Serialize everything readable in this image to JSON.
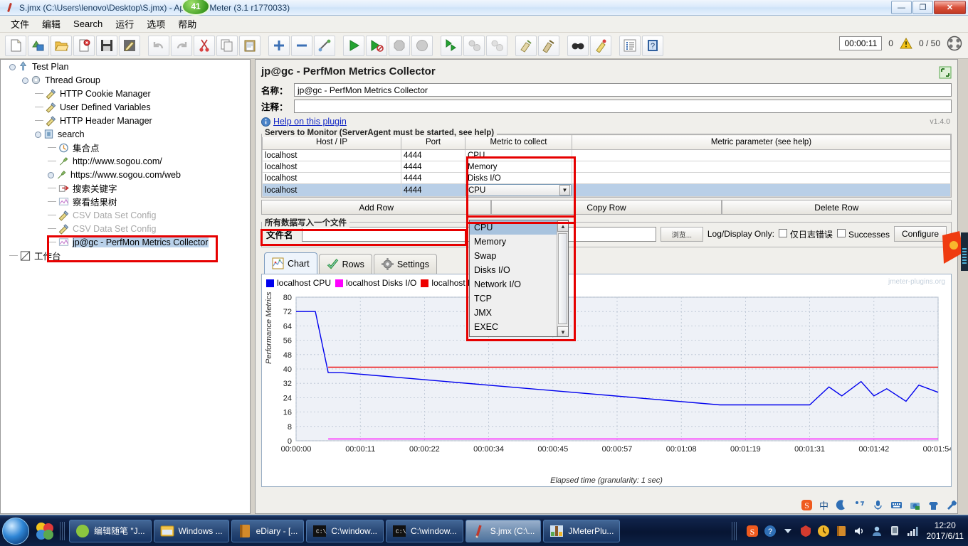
{
  "window": {
    "title": "S.jmx (C:\\Users\\lenovo\\Desktop\\S.jmx) - Apache JMeter (3.1 r1770033)",
    "badge": "41",
    "minimize": "—",
    "restore": "❐",
    "close": "✕"
  },
  "menu": {
    "items": [
      "文件",
      "编辑",
      "Search",
      "运行",
      "选项",
      "帮助"
    ]
  },
  "toolbar": {
    "icons": [
      "new-icon",
      "templates-icon",
      "open-icon",
      "close-icon",
      "save-icon",
      "save-as-icon",
      "undo-icon",
      "redo-icon",
      "cut-icon",
      "copy-icon",
      "paste-icon",
      "expand-all-icon",
      "collapse-all-icon",
      "toggle-icon",
      "start-icon",
      "start-no-timers-icon",
      "stop-icon",
      "shutdown-icon",
      "remote-start-all-icon",
      "remote-stop-all-icon",
      "remote-shutdown-all-icon",
      "clear-icon",
      "clear-all-icon",
      "search-icon",
      "search-reset-icon",
      "function-helper-icon",
      "help-icon"
    ],
    "elapsed": "00:00:11",
    "warning_count": "0",
    "thread_count": "0 / 50"
  },
  "tree": {
    "items": [
      {
        "label": "Test Plan",
        "indent": 0,
        "icon": "test-plan-icon",
        "disabled": false,
        "selected": false,
        "knob": true
      },
      {
        "label": "Thread Group",
        "indent": 1,
        "icon": "thread-group-icon",
        "disabled": false,
        "selected": false,
        "knob": true
      },
      {
        "label": "HTTP Cookie Manager",
        "indent": 2,
        "icon": "config-icon",
        "disabled": false,
        "selected": false,
        "knob": false
      },
      {
        "label": "User Defined Variables",
        "indent": 2,
        "icon": "config-icon",
        "disabled": false,
        "selected": false,
        "knob": false
      },
      {
        "label": "HTTP Header Manager",
        "indent": 2,
        "icon": "config-icon",
        "disabled": false,
        "selected": false,
        "knob": false
      },
      {
        "label": "search",
        "indent": 2,
        "icon": "controller-icon",
        "disabled": false,
        "selected": false,
        "knob": true
      },
      {
        "label": "集合点",
        "indent": 3,
        "icon": "timer-icon",
        "disabled": false,
        "selected": false,
        "knob": false
      },
      {
        "label": "http://www.sogou.com/",
        "indent": 3,
        "icon": "sampler-icon",
        "disabled": false,
        "selected": false,
        "knob": false
      },
      {
        "label": "https://www.sogou.com/web",
        "indent": 3,
        "icon": "sampler-icon",
        "disabled": false,
        "selected": false,
        "knob": true
      },
      {
        "label": "搜索关键字",
        "indent": 3,
        "icon": "post-processor-icon",
        "disabled": false,
        "selected": false,
        "knob": false
      },
      {
        "label": "察看结果树",
        "indent": 3,
        "icon": "listener-icon",
        "disabled": false,
        "selected": false,
        "knob": false
      },
      {
        "label": "CSV Data Set Config",
        "indent": 3,
        "icon": "config-icon",
        "disabled": true,
        "selected": false,
        "knob": false
      },
      {
        "label": "CSV Data Set Config",
        "indent": 3,
        "icon": "config-icon",
        "disabled": true,
        "selected": false,
        "knob": false
      },
      {
        "label": "jp@gc - PerfMon Metrics Collector",
        "indent": 3,
        "icon": "listener-icon",
        "disabled": false,
        "selected": true,
        "knob": false
      },
      {
        "label": "工作台",
        "indent": 0,
        "icon": "workbench-icon",
        "disabled": false,
        "selected": false,
        "knob": false
      }
    ]
  },
  "panel": {
    "title": "jp@gc - PerfMon Metrics Collector",
    "name_label": "名称：",
    "name_value": "jp@gc - PerfMon Metrics Collector",
    "comment_label": "注释：",
    "comment_value": "",
    "help_link": "Help on this plugin",
    "version": "v1.4.0",
    "servers_legend": "Servers to Monitor (ServerAgent must be started, see help)",
    "table": {
      "headers": [
        "Host / IP",
        "Port",
        "Metric to collect",
        "Metric parameter (see help)"
      ],
      "rows": [
        {
          "host": "localhost",
          "port": "4444",
          "metric": "CPU",
          "param": "",
          "selected": false,
          "editing": false
        },
        {
          "host": "localhost",
          "port": "4444",
          "metric": "Memory",
          "param": "",
          "selected": false,
          "editing": false
        },
        {
          "host": "localhost",
          "port": "4444",
          "metric": "Disks I/O",
          "param": "",
          "selected": false,
          "editing": false
        },
        {
          "host": "localhost",
          "port": "4444",
          "metric": "CPU",
          "param": "",
          "selected": true,
          "editing": true
        }
      ]
    },
    "buttons": {
      "add_row": "Add Row",
      "copy_row": "Copy Row",
      "delete_row": "Delete Row"
    },
    "file_legend": "所有数据写入一个文件",
    "file_label": "文件名",
    "file_value": "",
    "browse": "浏览...",
    "log_display_only": "Log/Display Only:",
    "errors_only": "仅日志错误",
    "successes": "Successes",
    "configure": "Configure"
  },
  "metric_dropdown": {
    "options": [
      "CPU",
      "Memory",
      "Swap",
      "Disks I/O",
      "Network I/O",
      "TCP",
      "JMX",
      "EXEC"
    ],
    "selected": "CPU",
    "up_arrow": "▲",
    "down_arrow": "▼"
  },
  "tabs": [
    {
      "label": "Chart",
      "icon": "chart-icon",
      "active": true
    },
    {
      "label": "Rows",
      "icon": "rows-check-icon",
      "active": false
    },
    {
      "label": "Settings",
      "icon": "gear-icon",
      "active": false
    }
  ],
  "chart_data": {
    "type": "line",
    "title": "",
    "xlabel": "Elapsed time (granularity: 1 sec)",
    "ylabel": "Performance Metrics",
    "watermark": "jmeter-plugins.org",
    "ylim": [
      0,
      80
    ],
    "yticks": [
      0,
      8,
      16,
      24,
      32,
      40,
      48,
      56,
      64,
      72,
      80
    ],
    "xticks": [
      "00:00:00",
      "00:00:11",
      "00:00:22",
      "00:00:34",
      "00:00:45",
      "00:00:57",
      "00:01:08",
      "00:01:19",
      "00:01:31",
      "00:01:42",
      "00:01:54"
    ],
    "grid": true,
    "legend_position": "top-left",
    "legend": [
      {
        "label": "localhost CPU",
        "color": "#0000ee"
      },
      {
        "label": "localhost Disks I/O",
        "color": "#ff00ff"
      },
      {
        "label": "localhost Memory",
        "color": "#ee0000"
      }
    ],
    "series": [
      {
        "name": "localhost CPU",
        "color": "#0000ee",
        "x": [
          0,
          3,
          5,
          7,
          66,
          80,
          83,
          85,
          88,
          90,
          92,
          95,
          97,
          100
        ],
        "values": [
          72,
          72,
          38,
          38,
          20,
          20,
          30,
          25,
          33,
          25,
          29,
          22,
          31,
          27
        ]
      },
      {
        "name": "localhost Memory",
        "color": "#ee0000",
        "x": [
          5,
          100
        ],
        "values": [
          41,
          41
        ]
      },
      {
        "name": "localhost Disks I/O",
        "color": "#ff00ff",
        "x": [
          5,
          100
        ],
        "values": [
          1,
          1
        ]
      }
    ]
  },
  "taskbar": {
    "tasks": [
      {
        "label": "编辑随笔 \"J...",
        "icon": "browser-icon",
        "active": false
      },
      {
        "label": "Windows ...",
        "icon": "explorer-icon",
        "active": false
      },
      {
        "label": "eDiary - [...",
        "icon": "ediary-icon",
        "active": false
      },
      {
        "label": "C:\\window...",
        "icon": "cmd-icon",
        "active": false
      },
      {
        "label": "C:\\window...",
        "icon": "cmd-icon",
        "active": false
      },
      {
        "label": "S.jmx (C:\\...",
        "icon": "jmeter-icon",
        "active": true
      },
      {
        "label": "JMeterPlu...",
        "icon": "jmeterplugins-icon",
        "active": false
      }
    ],
    "tray": [
      "sogou-icon",
      "help-icon",
      "arrow-icon",
      "security-icon",
      "update-icon",
      "ediary-tray-icon",
      "volume-icon",
      "user-icon",
      "device-icon",
      "network-icon"
    ],
    "time": "12:20",
    "date": "2017/6/11"
  },
  "ime": {
    "icons": [
      "sogou-logo-icon",
      "chinese-mode-icon",
      "moon-icon",
      "punct-icon",
      "mic-icon",
      "keyboard-icon",
      "screenshot-icon",
      "skin-icon",
      "tools-icon"
    ],
    "mode": "中"
  }
}
